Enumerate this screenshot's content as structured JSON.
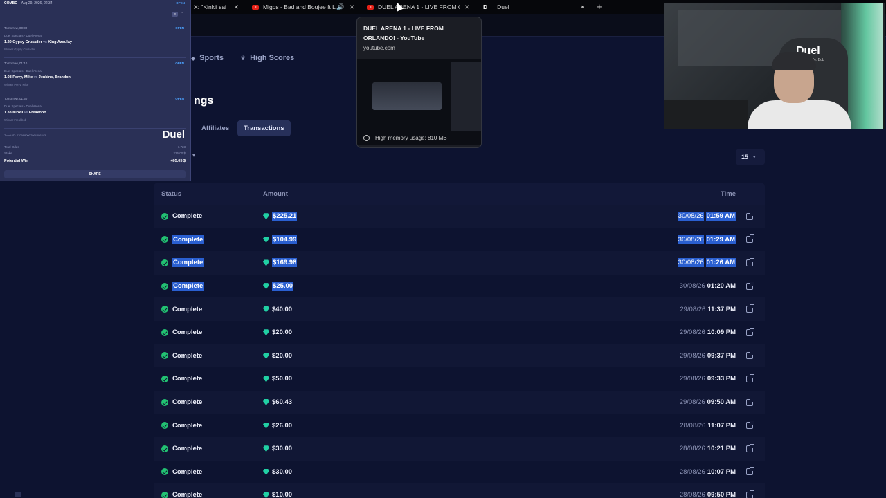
{
  "browser": {
    "tabs": [
      {
        "label": "X: \"Kinkii sai",
        "type": "x"
      },
      {
        "label": "Migos - Bad and Boujee ft L",
        "type": "youtube",
        "audio": true
      },
      {
        "label": "DUEL ARENA 1 - LIVE FROM OR",
        "type": "youtube"
      },
      {
        "label": "Duel",
        "type": "site"
      }
    ],
    "add_tab": "+",
    "close_glyph": "✕"
  },
  "hover_card": {
    "title": "DUEL ARENA 1 - LIVE FROM ORLANDO! - YouTube",
    "domain": "youtube.com",
    "memory": "High memory usage: 810 MB"
  },
  "nav": {
    "sports": "Sports",
    "high_scores": "High Scores"
  },
  "page": {
    "heading": "ngs",
    "subtabs": [
      "Affiliates",
      "Transactions"
    ],
    "active_subtab": "Transactions",
    "page_size": "15"
  },
  "table": {
    "headers": {
      "status": "Status",
      "amount": "Amount",
      "time": "Time"
    },
    "rows": [
      {
        "status": "Complete",
        "amount": "$225.21",
        "date": "30/08/26",
        "time": "01:59 AM",
        "status_hl": false,
        "amount_hl": true,
        "time_hl": true
      },
      {
        "status": "Complete",
        "amount": "$104.99",
        "date": "30/08/26",
        "time": "01:29 AM",
        "status_hl": true,
        "amount_hl": true,
        "time_hl": true
      },
      {
        "status": "Complete",
        "amount": "$169.98",
        "date": "30/08/26",
        "time": "01:26 AM",
        "status_hl": true,
        "amount_hl": true,
        "time_hl": true
      },
      {
        "status": "Complete",
        "amount": "$25.00",
        "date": "30/08/26",
        "time": "01:20 AM",
        "status_hl": true,
        "amount_hl": true,
        "time_hl": false
      },
      {
        "status": "Complete",
        "amount": "$40.00",
        "date": "29/08/26",
        "time": "11:37 PM"
      },
      {
        "status": "Complete",
        "amount": "$20.00",
        "date": "29/08/26",
        "time": "10:09 PM"
      },
      {
        "status": "Complete",
        "amount": "$20.00",
        "date": "29/08/26",
        "time": "09:37 PM"
      },
      {
        "status": "Complete",
        "amount": "$50.00",
        "date": "29/08/26",
        "time": "09:33 PM"
      },
      {
        "status": "Complete",
        "amount": "$60.43",
        "date": "29/08/26",
        "time": "09:50 AM"
      },
      {
        "status": "Complete",
        "amount": "$26.00",
        "date": "28/08/26",
        "time": "11:07 PM"
      },
      {
        "status": "Complete",
        "amount": "$30.00",
        "date": "28/08/26",
        "time": "10:21 PM"
      },
      {
        "status": "Complete",
        "amount": "$30.00",
        "date": "28/08/26",
        "time": "10:07 PM"
      },
      {
        "status": "Complete",
        "amount": "$10.00",
        "date": "28/08/26",
        "time": "09:50 PM"
      }
    ]
  },
  "bet_slip": {
    "combo": "COMBO",
    "date": "Aug 29, 2026, 22:34",
    "open": "OPEN",
    "count": "3",
    "legs": [
      {
        "when": "Tomorrow, 00:30",
        "event": "Duel Specials - Duel Arena",
        "odds": "1.20",
        "home": "Gypsy Crusader",
        "away": "King Azoulay",
        "pick": "Winner Gypsy Crusader"
      },
      {
        "when": "Tomorrow, 01:10",
        "event": "Duel Specials - Duel Arena",
        "odds": "1.08",
        "home": "Perry, Mike",
        "away": "Jenkins, Brandon",
        "pick": "Winner Perry, Mike"
      },
      {
        "when": "Tomorrow, 01:50",
        "event": "Duel Specials - Duel Arena",
        "odds": "1.33",
        "home": "Kinkii",
        "away": "Freakbob",
        "pick": "Winner Freakbob"
      }
    ],
    "vs": "vs",
    "logo": "Duel",
    "ticket_id": "Ticket ID: 2709990007064806243",
    "total_odds_label": "Total Odds",
    "total_odds": "1.723",
    "stake_label": "Stake",
    "stake": "235.00 $",
    "potential_win_label": "Potential Win",
    "potential_win": "405.05 $",
    "share": "SHARE"
  },
  "webcam": {
    "brand": "Duel",
    "sub": "Code: Bob"
  },
  "colors": {
    "background": "#0d1330",
    "accent_green": "#22c272",
    "gem": "#21d0a4",
    "selection": "#2a5fd0"
  }
}
